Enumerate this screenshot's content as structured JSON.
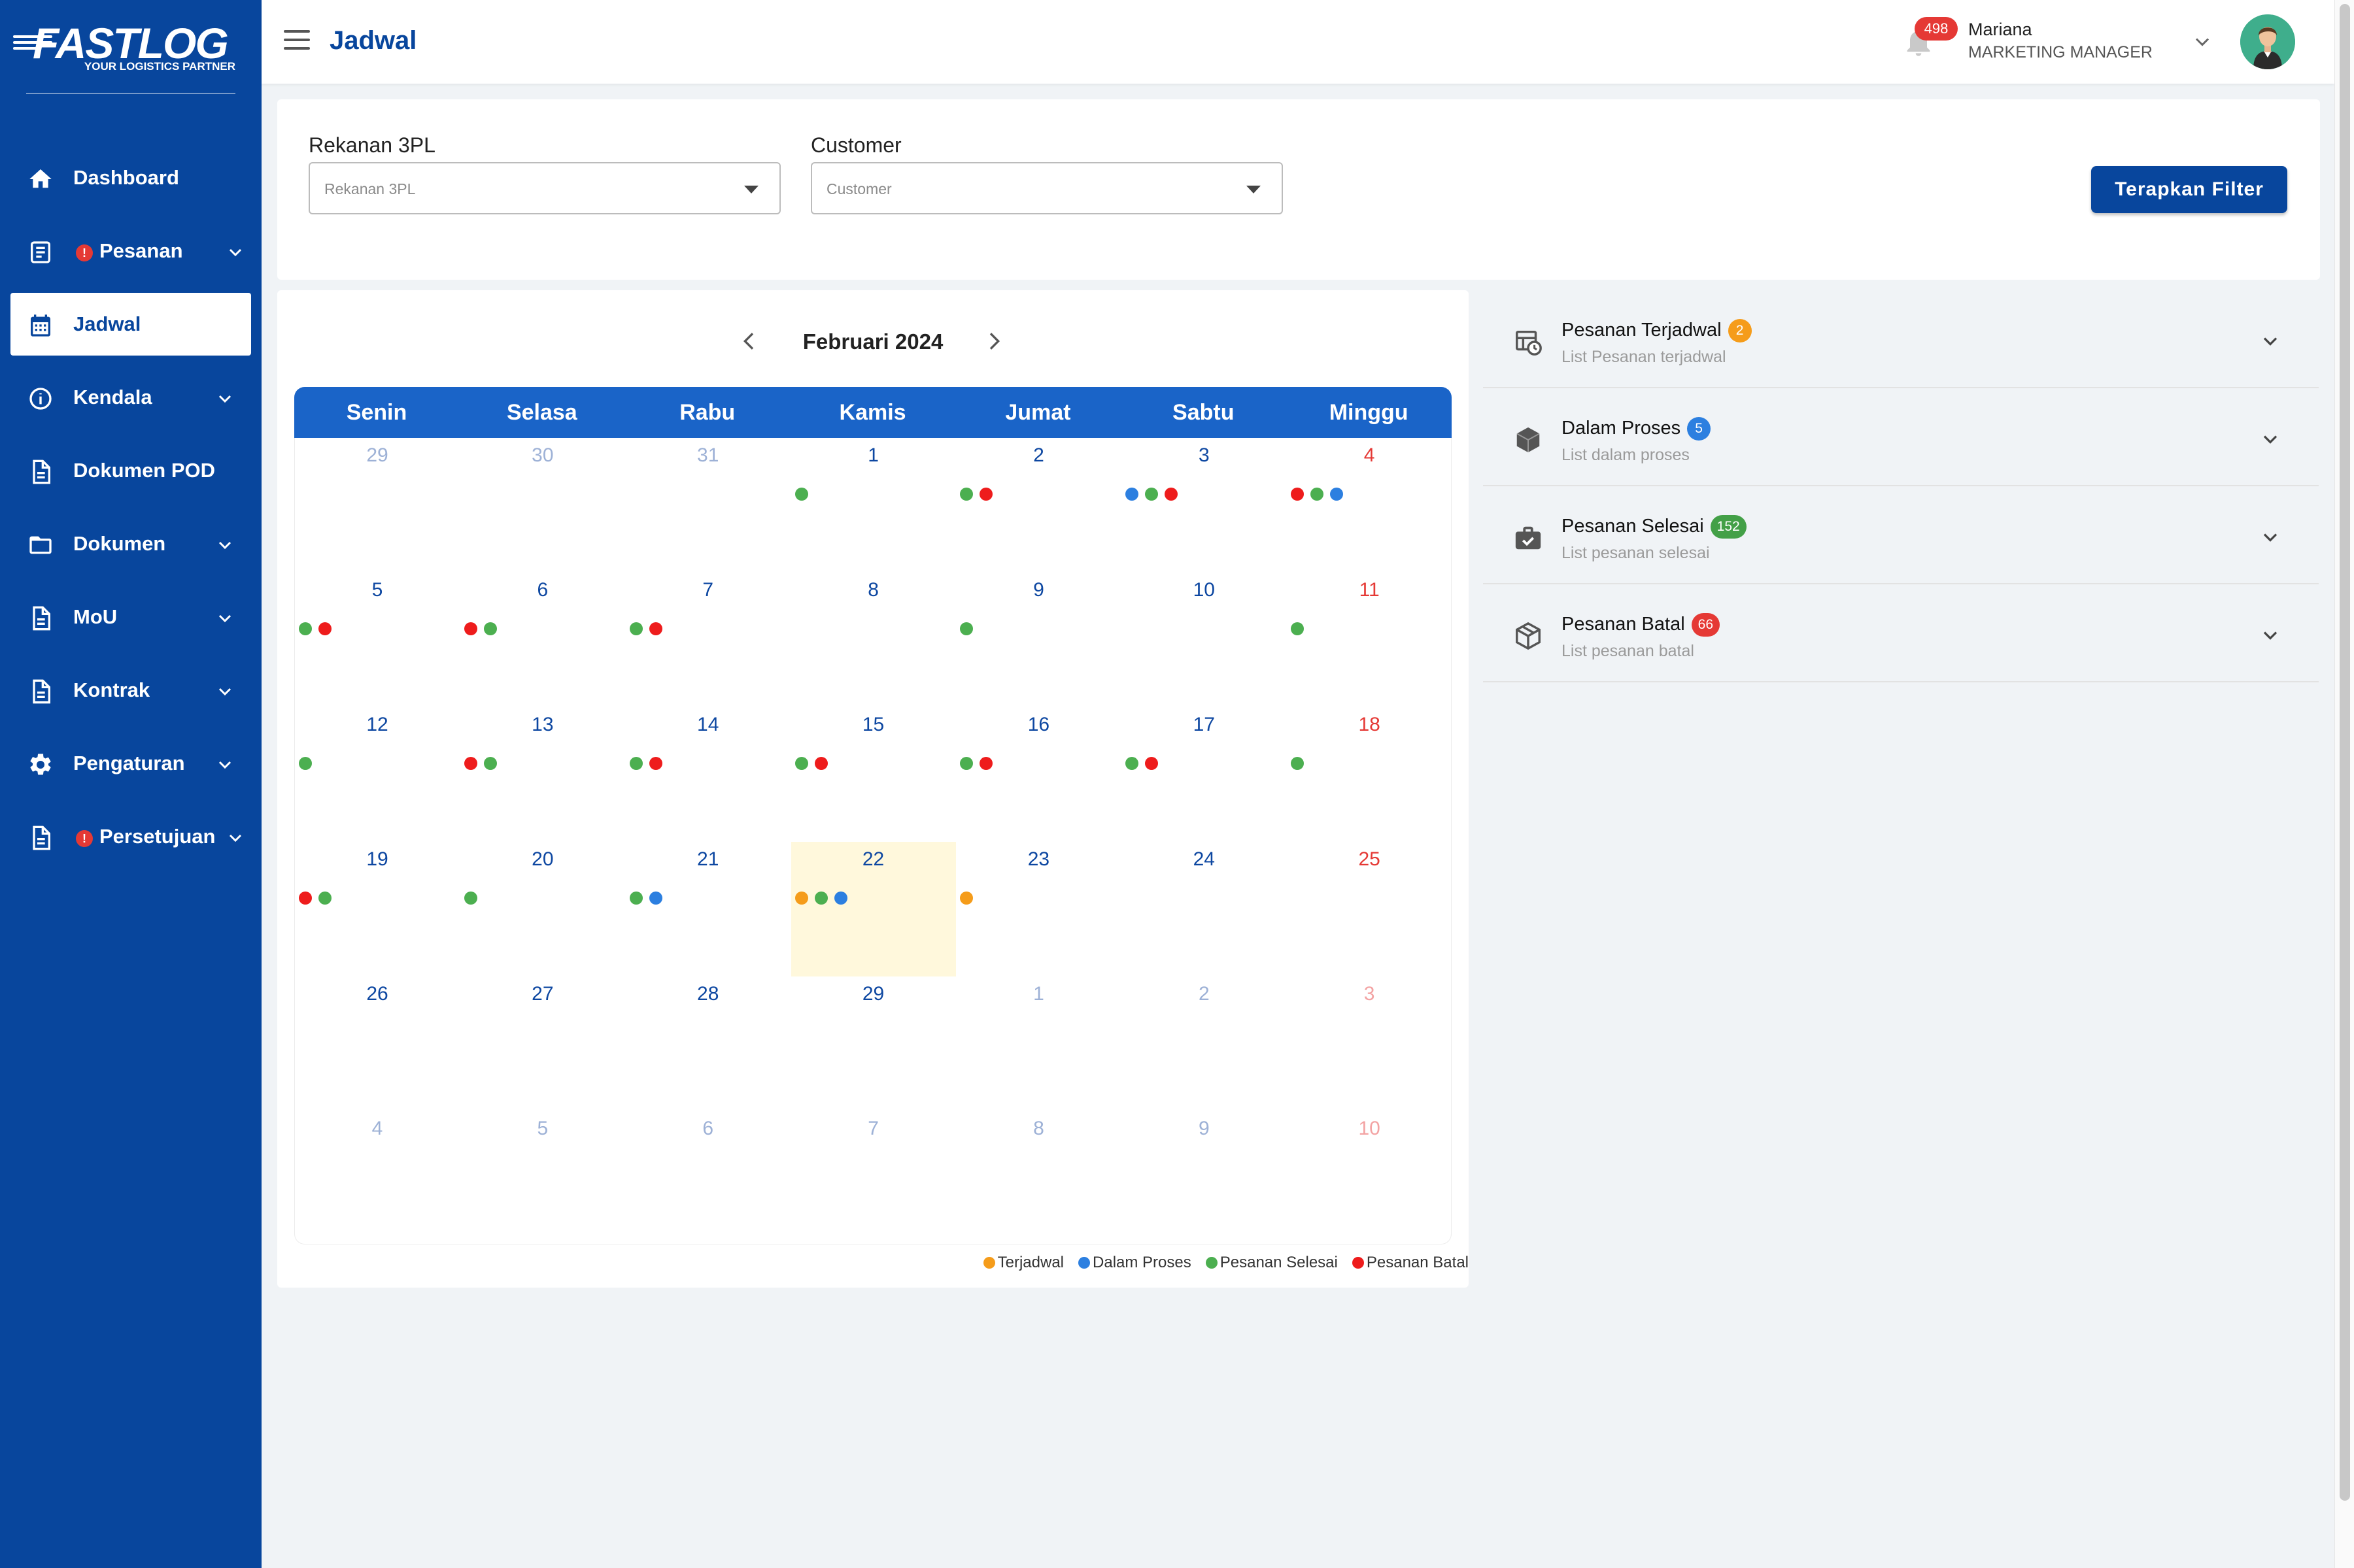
{
  "brand": {
    "name": "FASTLOG",
    "tagline": "YOUR LOGISTICS PARTNER"
  },
  "sidebar": {
    "items": [
      {
        "label": "Dashboard",
        "icon": "home-icon",
        "active": false,
        "alert": false,
        "expandable": false
      },
      {
        "label": "Pesanan",
        "icon": "receipt-icon",
        "active": false,
        "alert": true,
        "expandable": true
      },
      {
        "label": "Jadwal",
        "icon": "calendar-icon",
        "active": true,
        "alert": false,
        "expandable": false
      },
      {
        "label": "Kendala",
        "icon": "info-icon",
        "active": false,
        "alert": false,
        "expandable": true
      },
      {
        "label": "Dokumen POD",
        "icon": "document-icon",
        "active": false,
        "alert": false,
        "expandable": false
      },
      {
        "label": "Dokumen",
        "icon": "folder-icon",
        "active": false,
        "alert": false,
        "expandable": true
      },
      {
        "label": "MoU",
        "icon": "document-icon",
        "active": false,
        "alert": false,
        "expandable": true
      },
      {
        "label": "Kontrak",
        "icon": "document-icon",
        "active": false,
        "alert": false,
        "expandable": true
      },
      {
        "label": "Pengaturan",
        "icon": "gear-icon",
        "active": false,
        "alert": false,
        "expandable": true
      },
      {
        "label": "Persetujuan",
        "icon": "document-icon",
        "active": false,
        "alert": true,
        "expandable": true
      }
    ],
    "alert_glyph": "!"
  },
  "header": {
    "title": "Jadwal",
    "notification_count": "498",
    "user_name": "Mariana",
    "user_role": "MARKETING MANAGER"
  },
  "filters": {
    "rekanan_label": "Rekanan 3PL",
    "rekanan_placeholder": "Rekanan 3PL",
    "customer_label": "Customer",
    "customer_placeholder": "Customer",
    "apply_label": "Terapkan Filter"
  },
  "calendar": {
    "month_title": "Februari 2024",
    "weekdays": [
      "Senin",
      "Selasa",
      "Rabu",
      "Kamis",
      "Jumat",
      "Sabtu",
      "Minggu"
    ],
    "weeks": [
      [
        {
          "day": "29",
          "muted": true,
          "dots": []
        },
        {
          "day": "30",
          "muted": true,
          "dots": []
        },
        {
          "day": "31",
          "muted": true,
          "dots": []
        },
        {
          "day": "1",
          "dots": [
            "done"
          ]
        },
        {
          "day": "2",
          "dots": [
            "done",
            "cancel"
          ]
        },
        {
          "day": "3",
          "dots": [
            "proc",
            "done",
            "cancel"
          ]
        },
        {
          "day": "4",
          "dots": [
            "cancel",
            "done",
            "proc"
          ]
        }
      ],
      [
        {
          "day": "5",
          "dots": [
            "done",
            "cancel"
          ]
        },
        {
          "day": "6",
          "dots": [
            "cancel",
            "done"
          ]
        },
        {
          "day": "7",
          "dots": [
            "done",
            "cancel"
          ]
        },
        {
          "day": "8",
          "dots": []
        },
        {
          "day": "9",
          "dots": [
            "done"
          ]
        },
        {
          "day": "10",
          "dots": []
        },
        {
          "day": "11",
          "dots": [
            "done"
          ]
        }
      ],
      [
        {
          "day": "12",
          "dots": [
            "done"
          ]
        },
        {
          "day": "13",
          "dots": [
            "cancel",
            "done"
          ]
        },
        {
          "day": "14",
          "dots": [
            "done",
            "cancel"
          ]
        },
        {
          "day": "15",
          "dots": [
            "done",
            "cancel"
          ]
        },
        {
          "day": "16",
          "dots": [
            "done",
            "cancel"
          ]
        },
        {
          "day": "17",
          "dots": [
            "done",
            "cancel"
          ]
        },
        {
          "day": "18",
          "dots": [
            "done"
          ]
        }
      ],
      [
        {
          "day": "19",
          "dots": [
            "cancel",
            "done"
          ]
        },
        {
          "day": "20",
          "dots": [
            "done"
          ]
        },
        {
          "day": "21",
          "dots": [
            "done",
            "proc"
          ]
        },
        {
          "day": "22",
          "today": true,
          "dots": [
            "sched",
            "done",
            "proc"
          ]
        },
        {
          "day": "23",
          "dots": [
            "sched"
          ]
        },
        {
          "day": "24",
          "dots": []
        },
        {
          "day": "25",
          "dots": []
        }
      ],
      [
        {
          "day": "26",
          "dots": []
        },
        {
          "day": "27",
          "dots": []
        },
        {
          "day": "28",
          "dots": []
        },
        {
          "day": "29",
          "dots": []
        },
        {
          "day": "1",
          "muted": true,
          "dots": []
        },
        {
          "day": "2",
          "muted": true,
          "dots": []
        },
        {
          "day": "3",
          "muted": true,
          "dots": []
        }
      ],
      [
        {
          "day": "4",
          "muted": true,
          "dots": []
        },
        {
          "day": "5",
          "muted": true,
          "dots": []
        },
        {
          "day": "6",
          "muted": true,
          "dots": []
        },
        {
          "day": "7",
          "muted": true,
          "dots": []
        },
        {
          "day": "8",
          "muted": true,
          "dots": []
        },
        {
          "day": "9",
          "muted": true,
          "dots": []
        },
        {
          "day": "10",
          "muted": true,
          "dots": []
        }
      ]
    ],
    "legend": [
      {
        "key": "sched",
        "label": "Terjadwal",
        "color": "#f59c1a"
      },
      {
        "key": "proc",
        "label": "Dalam Proses",
        "color": "#2c7fe0"
      },
      {
        "key": "done",
        "label": "Pesanan Selesai",
        "color": "#4caf50"
      },
      {
        "key": "cancel",
        "label": "Pesanan Batal",
        "color": "#ee1c1c"
      }
    ]
  },
  "status_panel": [
    {
      "title": "Pesanan Terjadwal",
      "count": "2",
      "badge_color": "#f59c1a",
      "subtitle": "List Pesanan terjadwal",
      "icon": "schedule-icon"
    },
    {
      "title": "Dalam Proses",
      "count": "5",
      "badge_color": "#2c7fe0",
      "subtitle": "List dalam proses",
      "icon": "box-icon"
    },
    {
      "title": "Pesanan Selesai",
      "count": "152",
      "badge_color": "#43a047",
      "subtitle": "List pesanan selesai",
      "icon": "briefcase-check-icon"
    },
    {
      "title": "Pesanan Batal",
      "count": "66",
      "badge_color": "#e53935",
      "subtitle": "List pesanan batal",
      "icon": "package-outline-icon"
    }
  ]
}
